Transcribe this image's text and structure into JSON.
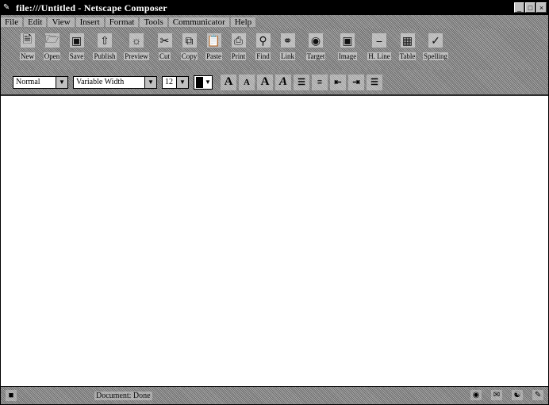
{
  "window": {
    "title": "file:///Untitled - Netscape Composer",
    "controls": {
      "minimize": "_",
      "maximize": "□",
      "close": "×"
    }
  },
  "menu": [
    {
      "label": "File"
    },
    {
      "label": "Edit"
    },
    {
      "label": "View"
    },
    {
      "label": "Insert"
    },
    {
      "label": "Format"
    },
    {
      "label": "Tools"
    },
    {
      "label": "Communicator"
    },
    {
      "label": "Help"
    }
  ],
  "toolbar": {
    "new": "New",
    "open": "Open",
    "save": "Save",
    "publish": "Publish",
    "preview": "Preview",
    "cut": "Cut",
    "copy": "Copy",
    "paste": "Paste",
    "print": "Print",
    "find": "Find",
    "link": "Link",
    "target": "Target",
    "image": "Image",
    "hline": "H. Line",
    "table": "Table",
    "spelling": "Spelling"
  },
  "formatbar": {
    "paragraph_style": "Normal",
    "font_face": "Variable Width",
    "font_size": "12",
    "text_color": "#000000"
  },
  "statusbar": {
    "text": "Document: Done"
  },
  "icons": {
    "app": "netscape-composer-icon",
    "status": "security-icon"
  }
}
